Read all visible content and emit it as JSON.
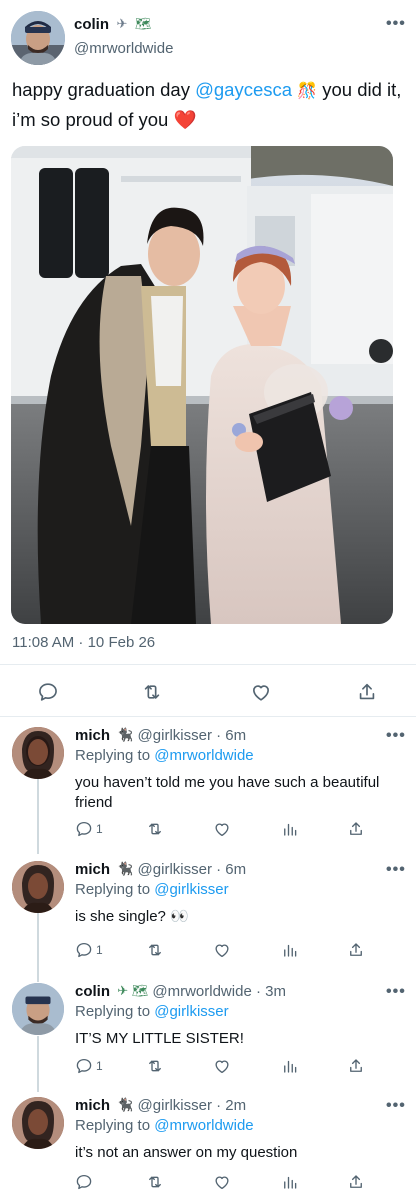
{
  "main_tweet": {
    "display_name": "colin",
    "name_emojis": [
      "✈",
      "🗺"
    ],
    "handle": "@mrworldwide",
    "text_before": "happy graduation day ",
    "mention": "@gaycesca",
    "text_emoji": "🎊",
    "text_after": " you did it, i’m so proud of you ",
    "heart_emoji": "❤️",
    "timestamp": "11:08 AM · 10 Feb 26",
    "more": "•••"
  },
  "main_actions": {
    "reply_icon": "reply-icon",
    "retweet_icon": "retweet-icon",
    "like_icon": "like-icon",
    "share_icon": "share-icon"
  },
  "replies": [
    {
      "display_name": "mich",
      "name_emoji": "🐈‍⬛",
      "handle": "@girlkisser",
      "time": "6m",
      "replying_prefix": "Replying to ",
      "replying_to": "@mrworldwide",
      "text": "you haven’t told me you have such a beautiful friend",
      "reply_count": "1",
      "more": "•••"
    },
    {
      "display_name": "mich",
      "name_emoji": "🐈‍⬛",
      "handle": "@girlkisser",
      "time": "6m",
      "replying_prefix": "Replying to ",
      "replying_to": "@girlkisser",
      "text": "is she single? 👀",
      "reply_count": "1",
      "more": "•••"
    },
    {
      "display_name": "colin",
      "name_emoji": "✈ 🗺",
      "handle": "@mrworldwide",
      "time": "3m",
      "replying_prefix": "Replying to ",
      "replying_to": "@girlkisser",
      "text": "IT’S MY LITTLE SISTER!",
      "reply_count": "1",
      "more": "•••"
    },
    {
      "display_name": "mich",
      "name_emoji": "🐈‍⬛",
      "handle": "@girlkisser",
      "time": "2m",
      "replying_prefix": "Replying to ",
      "replying_to": "@mrworldwide",
      "text": "it’s not an answer on my question",
      "reply_count": "",
      "more": "•••"
    }
  ],
  "colors": {
    "link": "#1d9bf0",
    "secondary": "#536471",
    "divider": "#e6ecf0"
  }
}
